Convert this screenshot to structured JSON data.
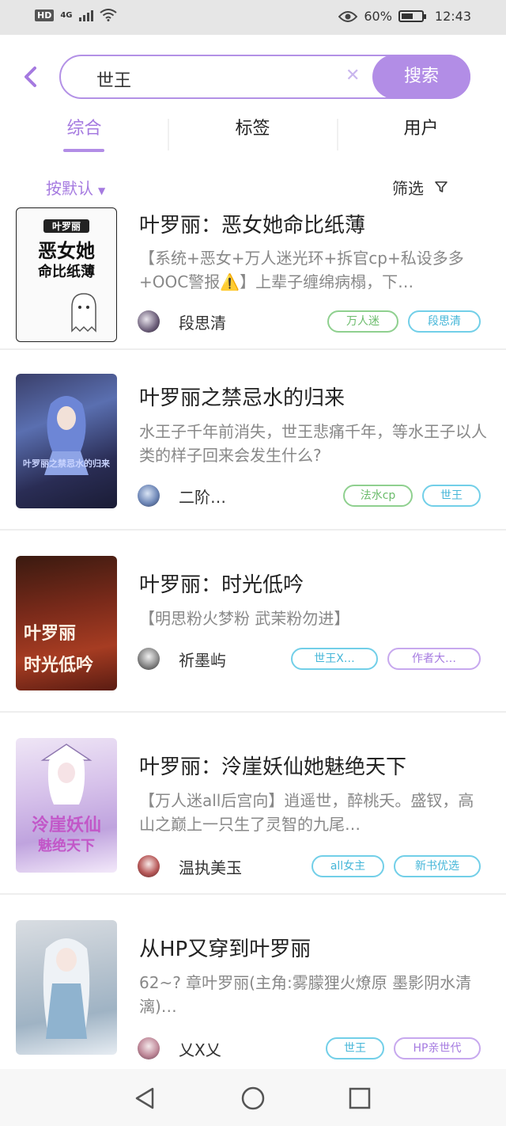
{
  "status_bar": {
    "hd": "HD",
    "network": "4G",
    "battery_percent": "60%",
    "time": "12:43",
    "icons": [
      "hd-icon",
      "signal-icon",
      "wifi-icon",
      "eye-icon",
      "battery-icon"
    ]
  },
  "search": {
    "query": "世王",
    "button_label": "搜索"
  },
  "tabs": [
    {
      "label": "综合",
      "active": true
    },
    {
      "label": "标签",
      "active": false
    },
    {
      "label": "用户",
      "active": false
    }
  ],
  "sort_label": "按默认",
  "filter_label": "筛选",
  "results": [
    {
      "title": "叶罗丽：恶女她命比纸薄",
      "description": "【系统+恶女+万人迷光环+拆官cp+私设多多+OOC警报⚠️】上辈子缠绵病榻，下…",
      "author": "段思清",
      "tags": [
        {
          "label": "万人迷",
          "color": "green"
        },
        {
          "label": "段思清",
          "color": "blue"
        }
      ],
      "cover_text": [
        "叶罗丽",
        "恶女她",
        "命比纸薄"
      ]
    },
    {
      "title": "叶罗丽之禁忌水的归来",
      "description": "水王子千年前消失，世王悲痛千年，等水王子以人类的样子回来会发生什么?",
      "author": "二阶…",
      "tags": [
        {
          "label": "法水cp",
          "color": "green"
        },
        {
          "label": "世王",
          "color": "blue"
        }
      ],
      "cover_text": [
        "叶罗丽之禁忌水的归来"
      ]
    },
    {
      "title": "叶罗丽：时光低吟",
      "description": "【明思粉火梦粉 武茉粉勿进】",
      "author": "祈墨屿",
      "tags": [
        {
          "label": "世王X…",
          "color": "blue"
        },
        {
          "label": "作者大…",
          "color": "purple"
        }
      ],
      "cover_text": [
        "叶罗丽",
        "时光低吟"
      ]
    },
    {
      "title": "叶罗丽：泠崖妖仙她魅绝天下",
      "description": "【万人迷all后宫向】逍遥世，醉桃夭。盛钗，高山之巅上一只生了灵智的九尾…",
      "author": "温执美玉",
      "tags": [
        {
          "label": "all女主",
          "color": "blue"
        },
        {
          "label": "新书优选",
          "color": "blue"
        }
      ],
      "cover_text": [
        "泠崖妖仙",
        "魅绝天下"
      ]
    },
    {
      "title": "从HP又穿到叶罗丽",
      "description": "62~? 章叶罗丽(主角:雾朦狸火燎原 墨影阴水清漓)…",
      "author": "乂X乂",
      "tags": [
        {
          "label": "世王",
          "color": "blue"
        },
        {
          "label": "HP亲世代",
          "color": "purple"
        }
      ],
      "cover_text": []
    }
  ],
  "nav_bar": [
    "back-triangle-icon",
    "home-circle-icon",
    "recents-square-icon"
  ]
}
